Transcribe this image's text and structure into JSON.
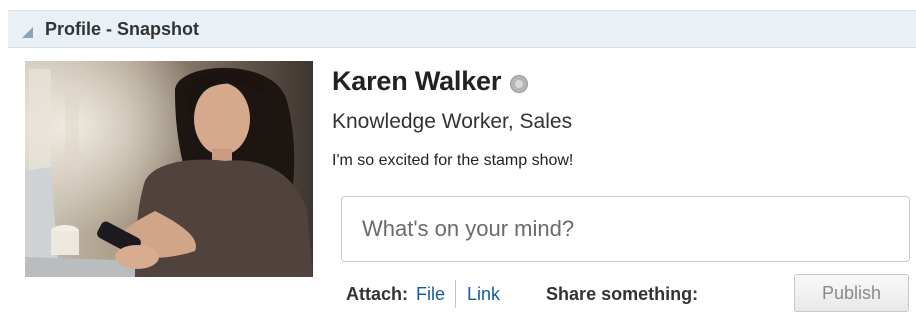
{
  "panel": {
    "title": "Profile - Snapshot",
    "collapse_icon": "collapse-triangle-icon"
  },
  "profile": {
    "avatar_icon": "user-photo",
    "name": "Karen Walker",
    "presence_icon": "presence-status-icon",
    "job_title": "Knowledge Worker, Sales",
    "status_message": "I'm so excited for the stamp show!"
  },
  "composer": {
    "placeholder": "What's on your mind?",
    "attach_label": "Attach:",
    "attach_file_label": "File",
    "attach_link_label": "Link",
    "share_label": "Share something:",
    "publish_label": "Publish"
  },
  "colors": {
    "header_bg": "#e9f1f6",
    "link": "#145c9e",
    "publish_text_disabled": "#8a8a8a"
  }
}
